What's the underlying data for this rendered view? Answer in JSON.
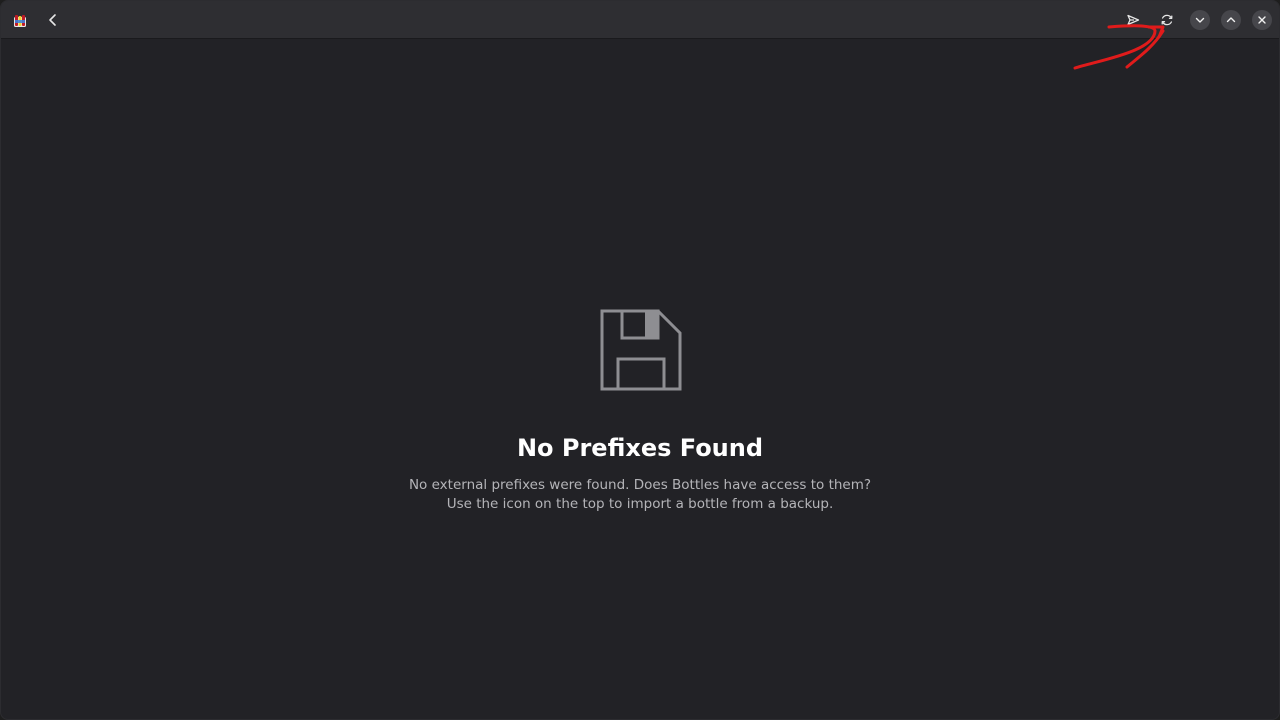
{
  "header": {
    "icons": {
      "app": "bottles-app-icon",
      "back": "chevron-left-icon",
      "import": "send-icon",
      "refresh": "refresh-icon",
      "minimize": "chevron-down-icon",
      "maximize": "chevron-up-icon",
      "close": "close-icon"
    }
  },
  "empty_state": {
    "icon": "floppy-disk-icon",
    "title": "No Prefixes Found",
    "description_line1": "No external prefixes were found. Does Bottles have access to them?",
    "description_line2": "Use the icon on the top to import a bottle from a backup."
  },
  "colors": {
    "background": "#222226",
    "headerbar": "#2e2e32",
    "title_text": "#ffffff",
    "description_text": "#b4b4b8",
    "annotation": "#e01b1b"
  }
}
